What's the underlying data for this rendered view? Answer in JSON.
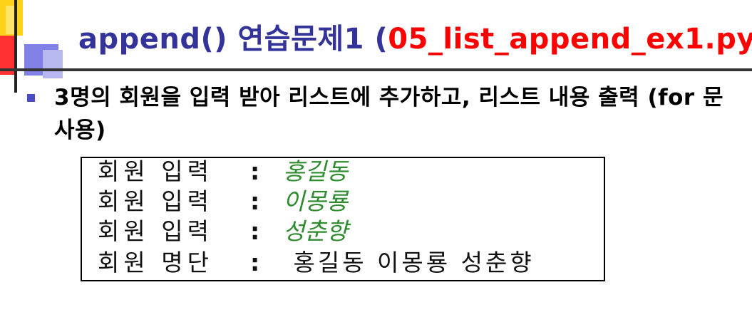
{
  "slide": {
    "title_prefix": "append() 연습문제1 ",
    "title_open": "(",
    "title_file": "05_list_append_ex1.py",
    "title_close": ")",
    "bullet_text": "3명의 회원을 입력 받아 리스트에 추가하고, 리스트 내용 출력 (for 문 사용)"
  },
  "console": {
    "rows": [
      {
        "label": "회원 입력",
        "colon": ":",
        "value": "홍길동",
        "kind": "input"
      },
      {
        "label": "회원 입력",
        "colon": ":",
        "value": "이몽룡",
        "kind": "input"
      },
      {
        "label": "회원 입력",
        "colon": ":",
        "value": "성춘향",
        "kind": "input"
      },
      {
        "label": "회원 명단",
        "colon": ":",
        "value": " 홍길동 이몽룡 성춘향",
        "kind": "output"
      }
    ]
  },
  "colors": {
    "title": "#333399",
    "file_name": "#ff0000",
    "input_value": "#2e8b2e",
    "bullet": "#4b4bc8"
  }
}
